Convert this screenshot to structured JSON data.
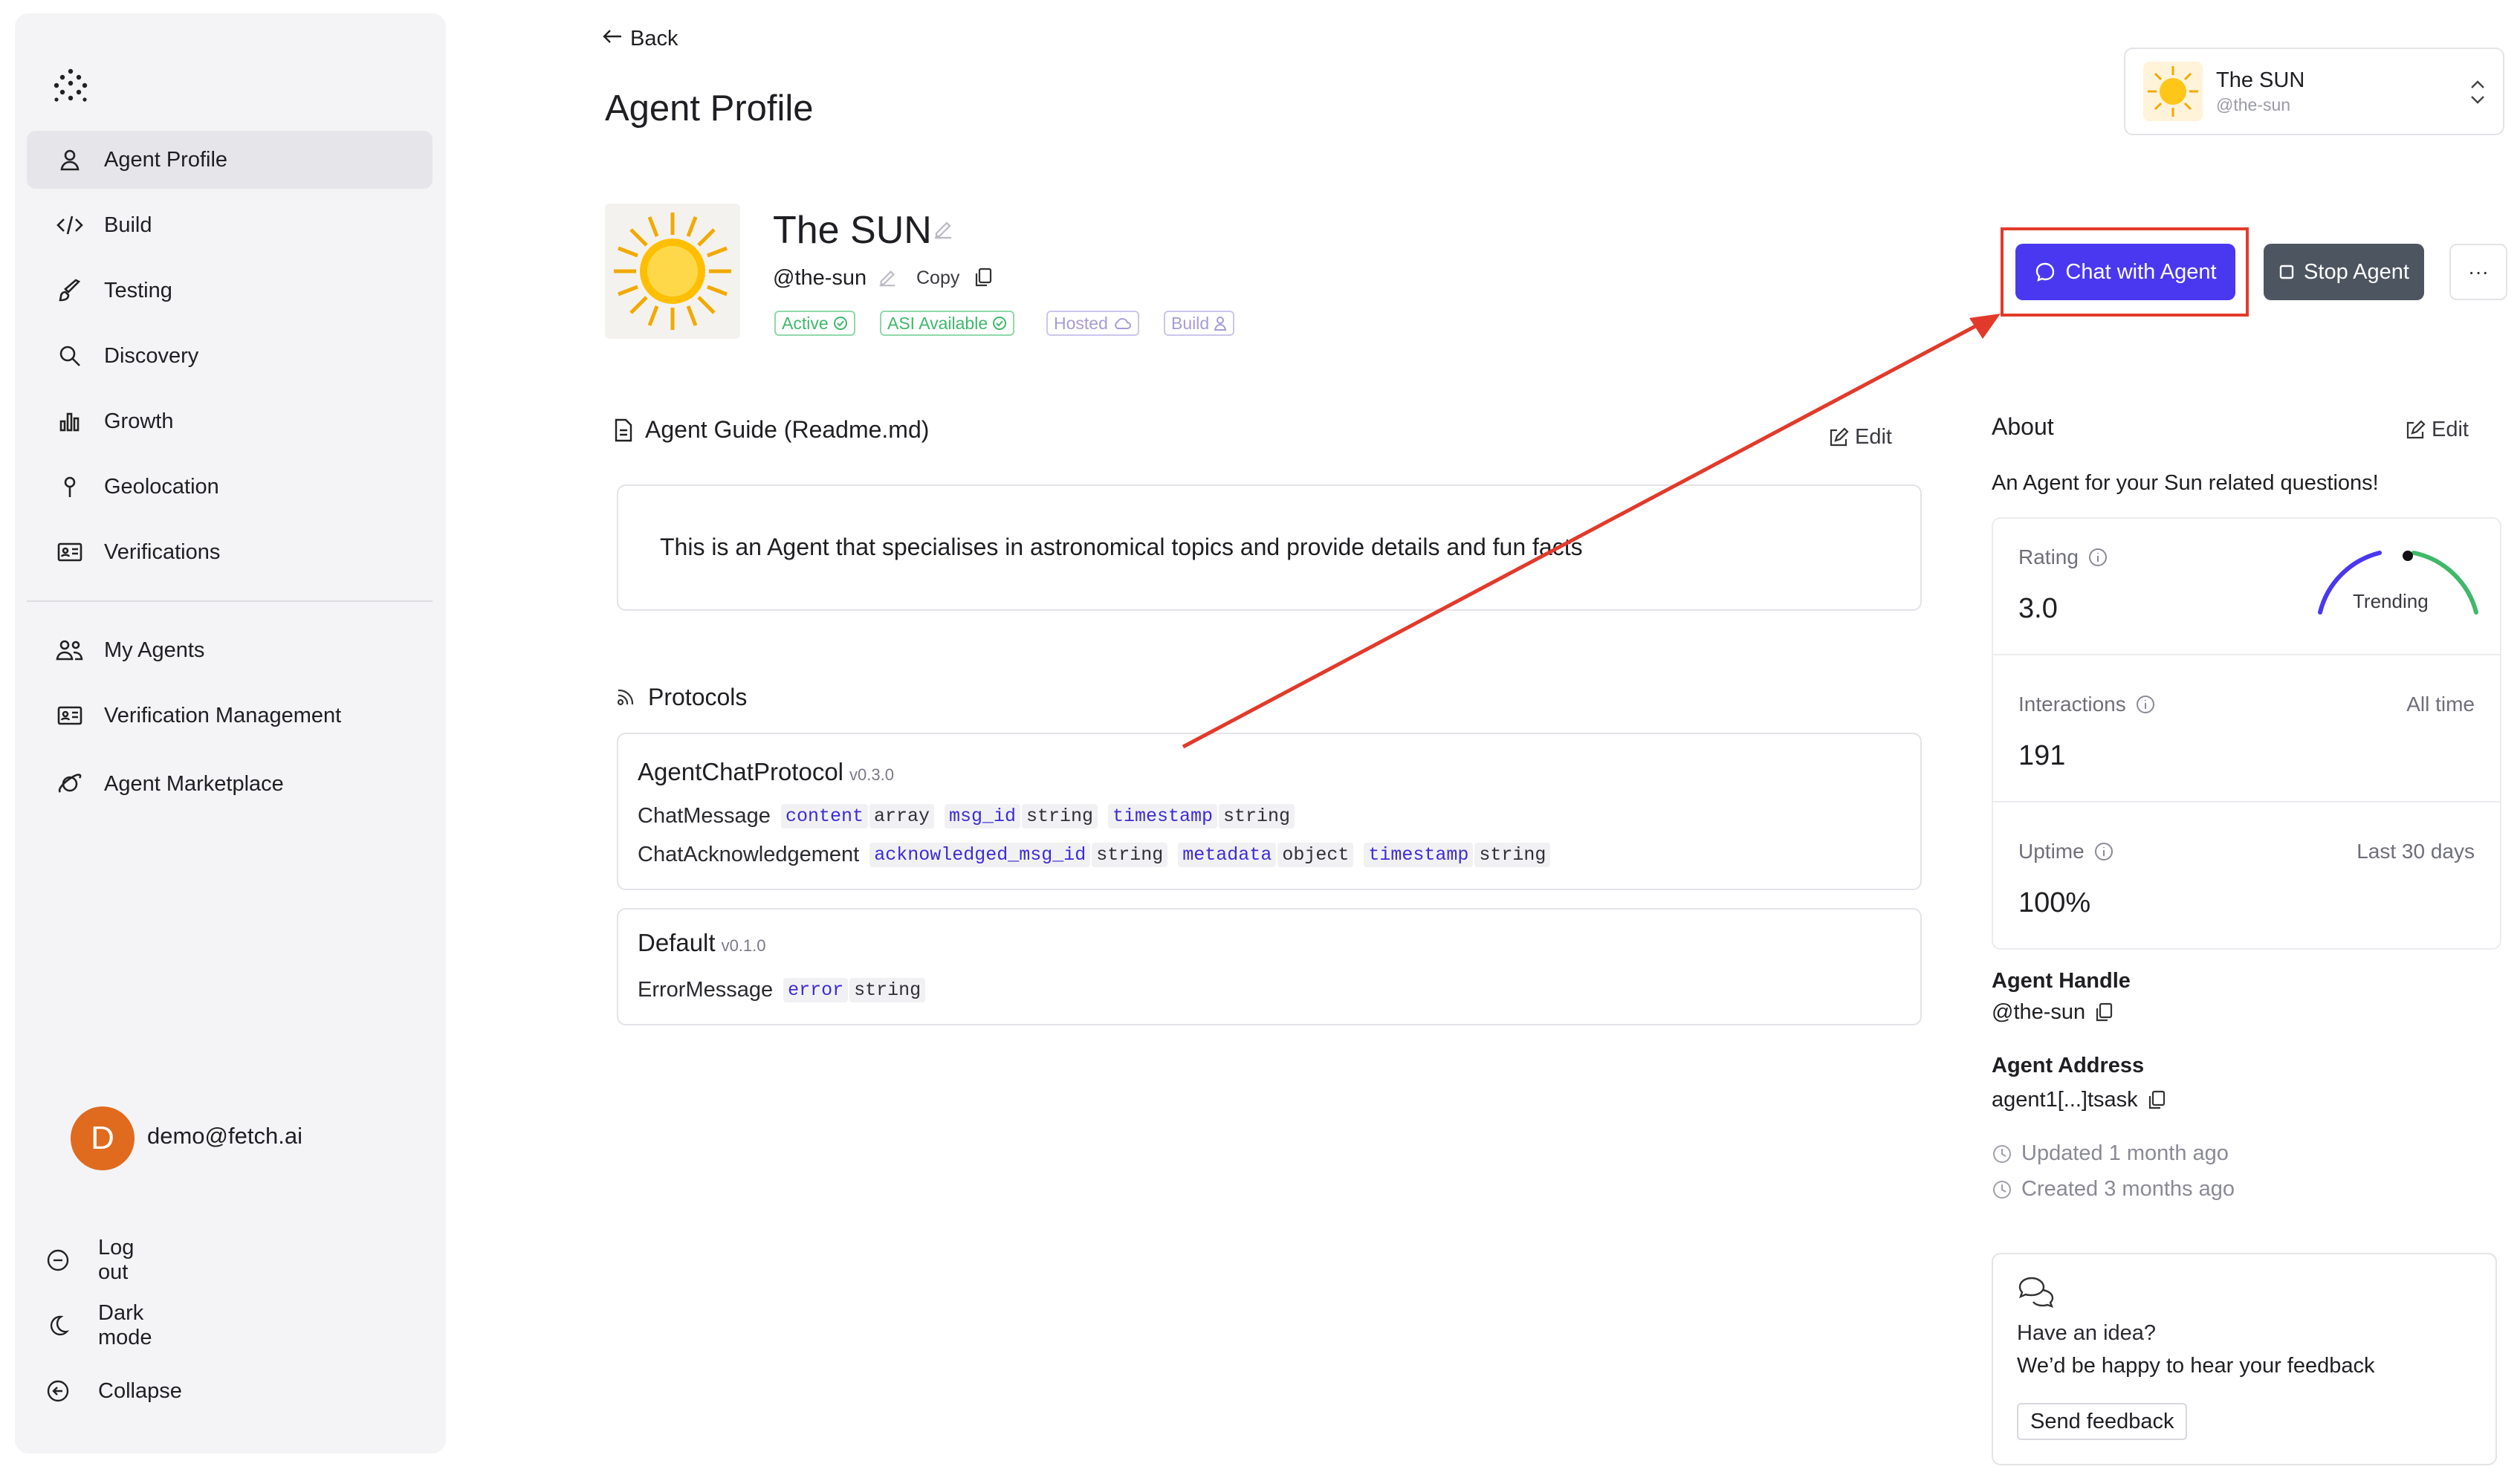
{
  "sidebar": {
    "items": [
      {
        "label": "Agent Profile",
        "icon": "user-icon",
        "active": true
      },
      {
        "label": "Build",
        "icon": "code-icon"
      },
      {
        "label": "Testing",
        "icon": "brush-icon"
      },
      {
        "label": "Discovery",
        "icon": "search-icon"
      },
      {
        "label": "Growth",
        "icon": "bar-chart-icon"
      },
      {
        "label": "Geolocation",
        "icon": "pin-icon"
      },
      {
        "label": "Verifications",
        "icon": "id-card-icon"
      }
    ],
    "secondary_items": [
      {
        "label": "My Agents",
        "icon": "users-icon"
      },
      {
        "label": "Verification Management",
        "icon": "id-card-icon"
      },
      {
        "label": "Agent Marketplace",
        "icon": "planet-icon"
      }
    ],
    "user": {
      "initial": "D",
      "email": "demo@fetch.ai"
    },
    "footer": [
      {
        "label": "Log out",
        "icon": "logout-icon"
      },
      {
        "label": "Dark mode",
        "icon": "moon-icon"
      },
      {
        "label": "Collapse",
        "icon": "collapse-icon"
      }
    ]
  },
  "header": {
    "back_label": "Back",
    "title": "Agent Profile",
    "agent_picker": {
      "name": "The SUN",
      "handle": "@the-sun"
    }
  },
  "agent": {
    "name": "The SUN",
    "handle": "@the-sun",
    "copy_label": "Copy",
    "badges": [
      {
        "label": "Active",
        "color": "#3fb86a"
      },
      {
        "label": "ASI Available",
        "color": "#3fb86a"
      },
      {
        "label": "Hosted",
        "color": "#a79bd6"
      },
      {
        "label": "Build",
        "color": "#a79bd6"
      }
    ]
  },
  "actions": {
    "chat_label": "Chat with Agent",
    "stop_label": "Stop Agent",
    "more_label": "···"
  },
  "readme": {
    "title": "Agent Guide (Readme.md)",
    "edit_label": "Edit",
    "text": "This is an Agent that specialises in astronomical topics and provide details and fun facts"
  },
  "protocols": {
    "title": "Protocols",
    "list": [
      {
        "name": "AgentChatProtocol",
        "version": "v0.3.0",
        "messages": [
          {
            "name": "ChatMessage",
            "fields": [
              [
                "content",
                "array"
              ],
              [
                "msg_id",
                "string"
              ],
              [
                "timestamp",
                "string"
              ]
            ]
          },
          {
            "name": "ChatAcknowledgement",
            "fields": [
              [
                "acknowledged_msg_id",
                "string"
              ],
              [
                "metadata",
                "object"
              ],
              [
                "timestamp",
                "string"
              ]
            ]
          }
        ]
      },
      {
        "name": "Default",
        "version": "v0.1.0",
        "messages": [
          {
            "name": "ErrorMessage",
            "fields": [
              [
                "error",
                "string"
              ]
            ]
          }
        ]
      }
    ]
  },
  "about": {
    "title": "About",
    "edit_label": "Edit",
    "description": "An Agent for your Sun related questions!",
    "rating": {
      "label": "Rating",
      "value": "3.0",
      "trend_label": "Trending"
    },
    "interactions": {
      "label": "Interactions",
      "value": "191",
      "period": "All time"
    },
    "uptime": {
      "label": "Uptime",
      "value": "100%",
      "period": "Last 30 days"
    },
    "handle_label": "Agent Handle",
    "handle_value": "@the-sun",
    "address_label": "Agent Address",
    "address_value": "agent1[...]tsask",
    "updated": "Updated 1 month ago",
    "created": "Created 3 months ago"
  },
  "feedback": {
    "line1": "Have an idea?",
    "line2": "We’d be happy to hear your feedback",
    "button_label": "Send feedback"
  },
  "colors": {
    "accent": "#4a38f0",
    "stop_button": "#4d5560",
    "annotation": "#e23a2a",
    "avatar": "#e06a1e"
  }
}
